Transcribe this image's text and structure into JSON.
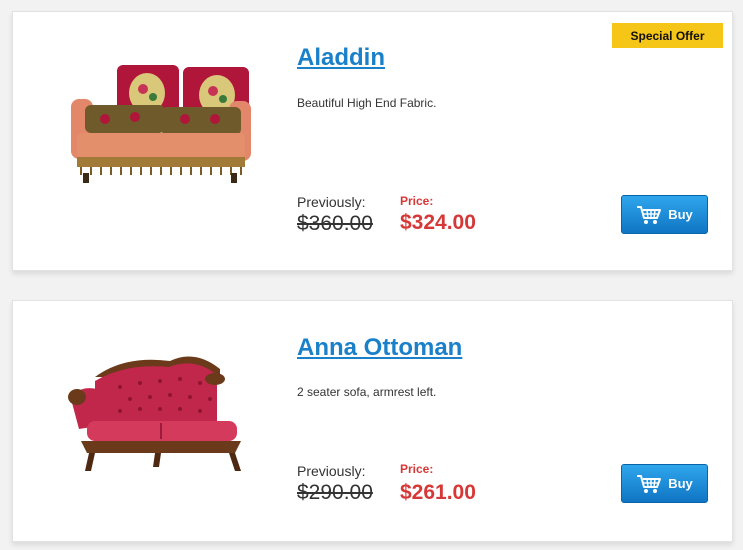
{
  "products": [
    {
      "name": "Aladdin",
      "description": "Beautiful High End Fabric.",
      "badge": "Special Offer",
      "previous_label": "Previously:",
      "previous_price": "$360.00",
      "price_label": "Price:",
      "price": "$324.00",
      "buy_label": "Buy",
      "image_icon": "sofa-floral-icon"
    },
    {
      "name": "Anna Ottoman",
      "description": "2 seater sofa, armrest left.",
      "previous_label": "Previously:",
      "previous_price": "$290.00",
      "price_label": "Price:",
      "price": "$261.00",
      "buy_label": "Buy",
      "image_icon": "sofa-red-velvet-icon"
    }
  ],
  "colors": {
    "link": "#1a80c9",
    "price": "#d63838",
    "badge_bg": "#f5c518",
    "button": "#1a8fdb"
  }
}
